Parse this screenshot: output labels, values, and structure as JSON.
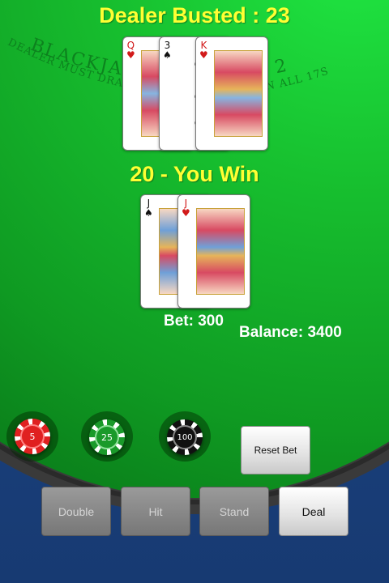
{
  "dealer": {
    "status": "Dealer Busted : 23",
    "cards": [
      {
        "rank": "Q",
        "suit": "hearts",
        "suit_glyph": "♥",
        "color": "red"
      },
      {
        "rank": "3",
        "suit": "spades",
        "suit_glyph": "♠",
        "color": "black"
      },
      {
        "rank": "K",
        "suit": "hearts",
        "suit_glyph": "♥",
        "color": "red"
      }
    ]
  },
  "player": {
    "status": "20 - You Win",
    "cards": [
      {
        "rank": "J",
        "suit": "spades",
        "suit_glyph": "♠",
        "color": "black"
      },
      {
        "rank": "J",
        "suit": "hearts",
        "suit_glyph": "♥",
        "color": "red"
      }
    ]
  },
  "table_text": {
    "line1": "BLACKJACK PAYS 3 TO 2",
    "line2": "DEALER MUST DRAW TO 16 AND STAND ON ALL 17S"
  },
  "bet": "Bet: 300",
  "balance": "Balance: 3400",
  "chips": [
    {
      "label": "5",
      "color": "#e02020"
    },
    {
      "label": "25",
      "color": "#1a9a2a"
    },
    {
      "label": "100",
      "color": "#111111"
    }
  ],
  "buttons": {
    "reset_bet": "Reset Bet",
    "double": "Double",
    "hit": "Hit",
    "stand": "Stand",
    "deal": "Deal"
  },
  "colors": {
    "title": "#ffff33",
    "felt": "#17c02f",
    "background": "#1e4a8c"
  }
}
